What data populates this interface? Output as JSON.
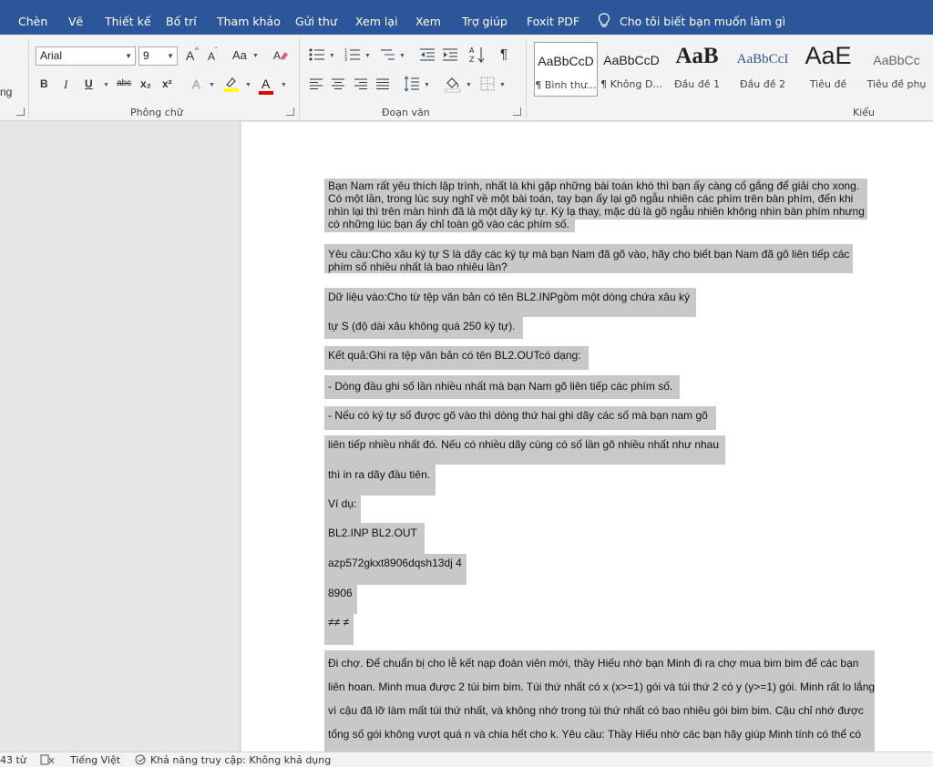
{
  "menu": {
    "tabs": [
      "Chèn",
      "Vẽ",
      "Thiết kế",
      "Bố trí",
      "Tham khảo",
      "Gửi thư",
      "Xem lại",
      "Xem",
      "Trợ giúp",
      "Foxit PDF"
    ],
    "tell_me": "Cho tôi biết bạn muốn làm gì"
  },
  "ribbon": {
    "clipboard_partial": "ng",
    "font_name": "Arial",
    "font_size": "9",
    "group_font": "Phông chữ",
    "group_paragraph": "Đoạn văn",
    "group_styles": "Kiểu",
    "change_case": "Aa",
    "grow_font": "A",
    "shrink_font": "A",
    "bold": "B",
    "italic": "I",
    "underline": "U",
    "strikethrough": "abc",
    "subscript": "x₂",
    "superscript": "x²",
    "font_color": "A",
    "styles": [
      {
        "sample": "AaBbCcD",
        "name": "¶ Bình thư..."
      },
      {
        "sample": "AaBbCcD",
        "name": "¶ Không D..."
      },
      {
        "sample": "AaB",
        "name": "Đầu đề 1"
      },
      {
        "sample": "AaBbCcI",
        "name": "Đầu đề 2"
      },
      {
        "sample": "AaE",
        "name": "Tiêu đề"
      },
      {
        "sample": "AaBbCc",
        "name": "Tiêu đề phụ"
      }
    ]
  },
  "document": {
    "p1": [
      "Bạn Nam rất yêu thích lập trình, nhất là khi gặp những bài toán khó thì bạn ấy càng cố gắng để giải cho xong.",
      "Có một lần, trong lúc suy nghĩ về một bài toán, tay bạn ấy lại gõ ngẫu nhiên các phím trên bàn phím, đến khi",
      "nhìn lại thì trên màn hình đã là một dãy ký tự. Kỳ lạ thay, mặc dù là gõ ngẫu nhiên không nhìn bàn phím nhưng",
      "có những lúc bạn ấy chỉ toàn gõ vào các phím số."
    ],
    "p2": [
      "Yêu cầu:Cho xâu ký tự S là dãy các ký tự mà bạn Nam đã gõ vào, hãy cho biết bạn Nam đã gõ liên tiếp các",
      "phím số nhiều nhất là bao nhiêu lần?"
    ],
    "p3": "Dữ liệu vào:Cho từ tệp văn bản có tên BL2.INPgồm một dòng chứa xâu ký",
    "p4": "tự S (độ dài xâu không quá 250 ký tự).",
    "p5": "Kết quả:Ghi ra tệp văn bản có tên BL2.OUTcó dạng:",
    "p6": "- Dòng đầu ghi số lần nhiều nhất mà bạn Nam gõ liên tiếp các phím số.",
    "p7": "- Nếu có ký tự số được gõ vào thì dòng thứ hai ghi dãy các số mà bạn nam gõ",
    "p8": "liên tiếp nhiều nhất đó. Nếu có nhiều dãy cùng có số lần gõ nhiều nhất như nhau",
    "p9": "thì in ra dãy đầu tiên.",
    "p10": "Ví dụ:",
    "p11": "BL2.INP BL2.OUT",
    "p12": "azp572gkxt8906dqsh13dj 4",
    "p13": "8906",
    "p14": "≠≠ ≠",
    "p15": "Đi chợ. Để chuẩn bị cho lễ kết nạp đoàn viên mới, thầy Hiếu nhờ bạn Minh đi ra chợ mua bim bim để các bạn",
    "p16": "liên hoan. Minh mua được 2 túi bim bim. Túi thứ nhất có x (x>=1) gói và túi thứ 2 có y (y>=1) gói. Minh rất lo lắng",
    "p17": "vì cậu đã lỡ làm mất túi thứ nhất, và không nhớ trong túi thứ nhất có bao nhiêu gói bim bim. Cậu chỉ nhớ được",
    "p18": "tổng số gói không vượt quá n và chia hết cho k. Yêu cầu: Thầy Hiếu nhờ các bạn hãy giúp Minh tính có thể có"
  },
  "status": {
    "words": "43 từ",
    "language": "Tiếng Việt",
    "accessibility": "Khả năng truy cập: Không khả dụng"
  }
}
